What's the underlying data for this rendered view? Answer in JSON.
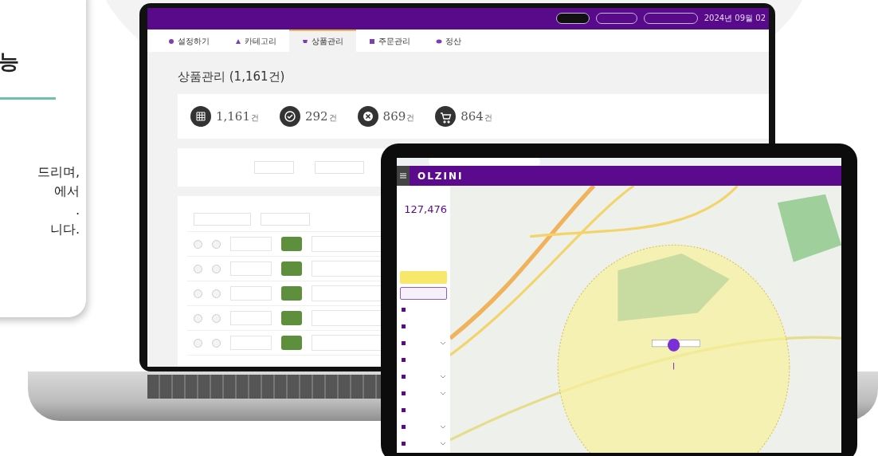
{
  "promo_card": {
    "heading_fragment": "능",
    "lines": [
      "드리며,",
      "에서",
      ".",
      "니다."
    ]
  },
  "laptop": {
    "header": {
      "date": "2024년 09월 02"
    },
    "tabs": [
      {
        "label": "설정하기",
        "selected": false,
        "kind": "gear"
      },
      {
        "label": "카테고리",
        "selected": false,
        "kind": "tree"
      },
      {
        "label": "상품관리",
        "selected": true,
        "kind": "cart"
      },
      {
        "label": "주문관리",
        "selected": false,
        "kind": "list"
      },
      {
        "label": "정산",
        "selected": false,
        "kind": "coin"
      }
    ],
    "page_title": "상품관리 (1,161건)",
    "stats": [
      {
        "kind": "grid",
        "value": "1,161",
        "unit": "건"
      },
      {
        "kind": "check",
        "value": "292",
        "unit": "건"
      },
      {
        "kind": "cross",
        "value": "869",
        "unit": "건"
      },
      {
        "kind": "cart",
        "value": "864",
        "unit": "건"
      }
    ],
    "rows": [
      {
        "checked": false,
        "marked": false
      },
      {
        "checked": false,
        "marked": false
      },
      {
        "checked": false,
        "marked": false
      },
      {
        "checked": false,
        "marked": false
      },
      {
        "checked": false,
        "marked": false
      }
    ]
  },
  "tablet": {
    "logo": "OLZINI",
    "amount": "127,476",
    "menu": [
      {
        "kind": "link"
      },
      {
        "kind": "link"
      },
      {
        "kind": "group"
      },
      {
        "kind": "link"
      },
      {
        "kind": "group"
      },
      {
        "kind": "group"
      },
      {
        "kind": "link"
      },
      {
        "kind": "group"
      },
      {
        "kind": "group"
      }
    ]
  }
}
